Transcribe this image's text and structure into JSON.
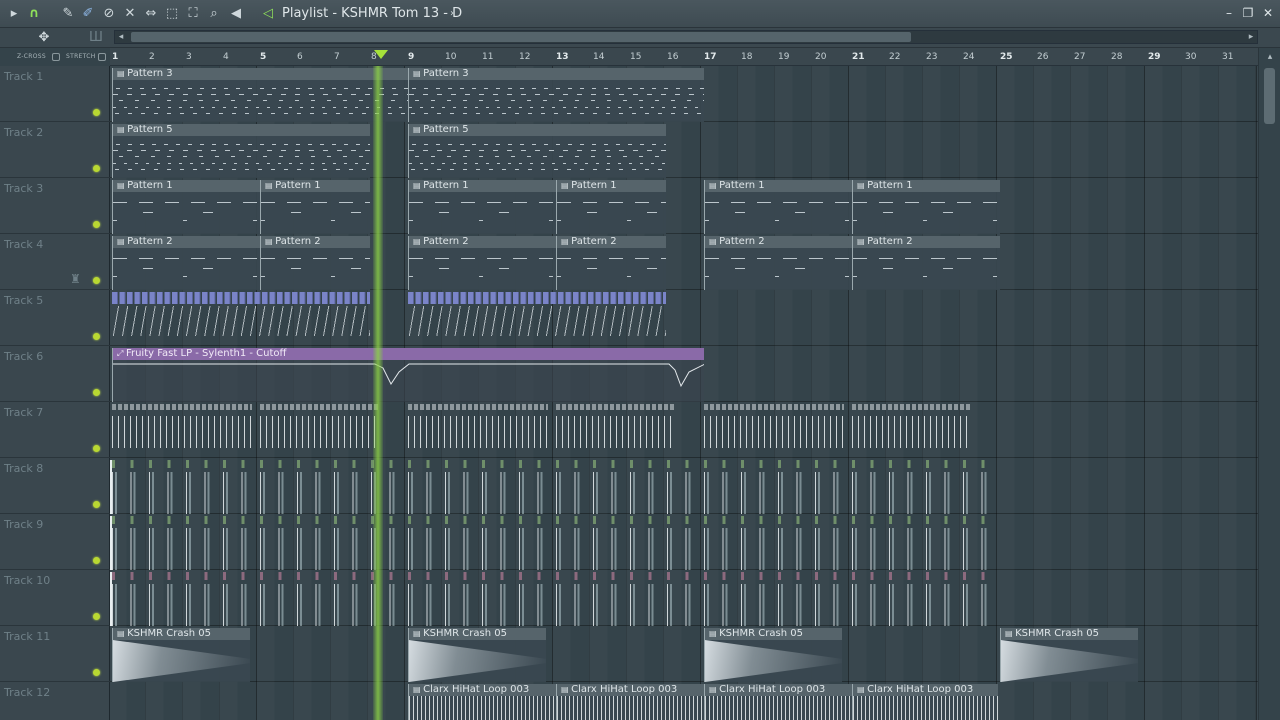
{
  "window": {
    "title": "Playlist - KSHMR Tom 13 - D",
    "controls": [
      "minimize-icon",
      "restore-icon",
      "close-icon"
    ]
  },
  "toolbar": {
    "icons": [
      "play-arrow-icon",
      "magnet-icon",
      "pencil-icon",
      "brush-icon",
      "delete-icon",
      "mute-icon",
      "slip-icon",
      "select-icon",
      "zoom-icon",
      "speaker-icon",
      "playlist-arrow-icon"
    ],
    "xcross_label": "Z-CROSS",
    "stretch_label": "STRETCH"
  },
  "ruler": {
    "bars": [
      "1",
      "2",
      "3",
      "4",
      "5",
      "6",
      "7",
      "8",
      "9",
      "10",
      "11",
      "12",
      "13",
      "14",
      "15",
      "16",
      "17",
      "18",
      "19",
      "20",
      "21",
      "22",
      "23",
      "24",
      "25",
      "26",
      "27",
      "28",
      "29",
      "30",
      "31"
    ]
  },
  "tracks": [
    {
      "name": "Track 1"
    },
    {
      "name": "Track 2"
    },
    {
      "name": "Track 3"
    },
    {
      "name": "Track 4"
    },
    {
      "name": "Track 5"
    },
    {
      "name": "Track 6"
    },
    {
      "name": "Track 7"
    },
    {
      "name": "Track 8"
    },
    {
      "name": "Track 9"
    },
    {
      "name": "Track 10"
    },
    {
      "name": "Track 11"
    },
    {
      "name": "Track 12"
    }
  ],
  "clips": {
    "pattern3": "Pattern 3",
    "pattern5": "Pattern 5",
    "pattern1": "Pattern 1",
    "pattern2": "Pattern 2",
    "automation": "Fruity Fast LP - Sylenth1 - Cutoff",
    "crash": "KSHMR Crash 05",
    "hihat": "Clarx HiHat Loop 003"
  },
  "colors": {
    "playhead": "#a6e23a",
    "track_dot": "#b9d832",
    "automation_clip": "#8a6aa8",
    "chop_slices": "#7a84c8"
  }
}
